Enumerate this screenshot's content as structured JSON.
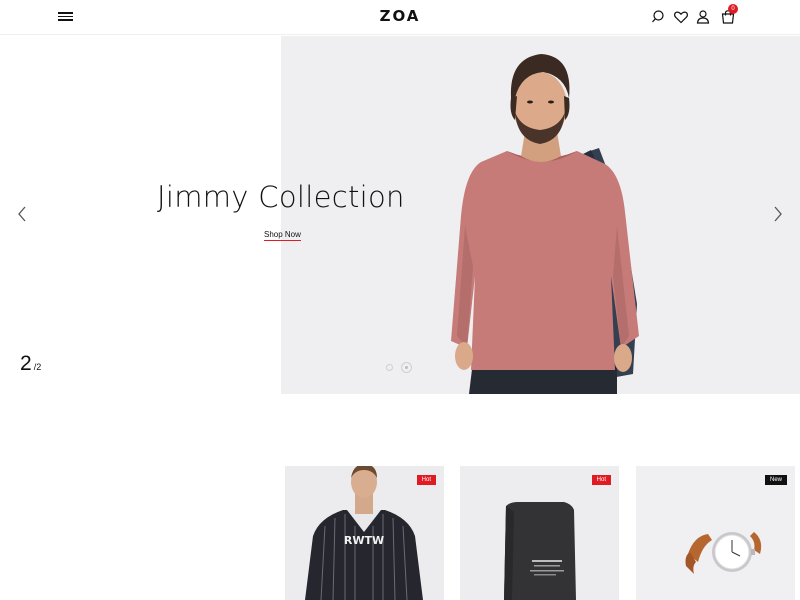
{
  "header": {
    "logo": "ZOA",
    "cart_count": "0",
    "icons": [
      "menu-icon",
      "search-icon",
      "heart-icon",
      "user-icon",
      "cart-icon"
    ]
  },
  "hero": {
    "title": "Jimmy Collection",
    "cta_label": "Shop Now",
    "slide_current": "2",
    "slide_total": "/2",
    "background_color": "#efeff1",
    "shirt_color": "#c67b79"
  },
  "products": [
    {
      "badge": "Hot",
      "badge_color": "#e01b24"
    },
    {
      "badge": "Hot",
      "badge_color": "#e01b24"
    },
    {
      "badge": "New",
      "badge_color": "#111111"
    }
  ],
  "colors": {
    "accent": "#e01b24"
  }
}
